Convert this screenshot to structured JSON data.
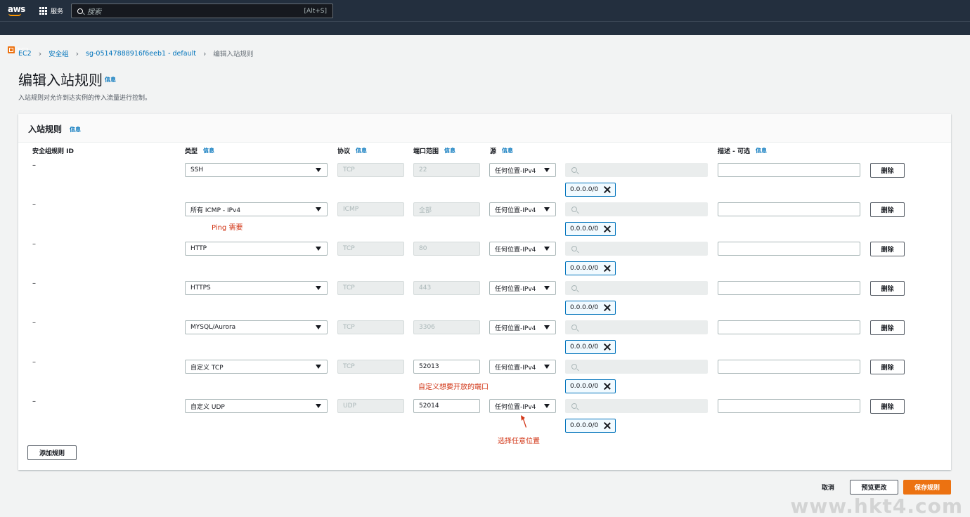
{
  "nav": {
    "logo": "aws",
    "services_label": "服务",
    "search_placeholder": "搜索",
    "search_shortcut": "[Alt+S]",
    "service_pill": "EC2"
  },
  "breadcrumb": {
    "items": [
      "EC2",
      "安全组",
      "sg-05147888916f6eeb1 - default"
    ],
    "current": "编辑入站规则"
  },
  "page": {
    "title": "编辑入站规则",
    "info": "信息",
    "description": "入站规则对允许到达实例的传入流量进行控制。"
  },
  "panel": {
    "title": "入站规则",
    "info": "信息",
    "columns": {
      "rule_id": "安全组规则 ID",
      "type": "类型",
      "protocol": "协议",
      "port_range": "端口范围",
      "source": "源",
      "description": "描述 - 可选",
      "info": "信息"
    },
    "rows": [
      {
        "id": "–",
        "type": "SSH",
        "protocol": "TCP",
        "port": "22",
        "source": "任何位置-IPv4",
        "cidr": "0.0.0.0/0",
        "delete": "删除"
      },
      {
        "id": "–",
        "type": "所有 ICMP - IPv4",
        "protocol": "ICMP",
        "port": "全部",
        "source": "任何位置-IPv4",
        "cidr": "0.0.0.0/0",
        "delete": "删除"
      },
      {
        "id": "–",
        "type": "HTTP",
        "protocol": "TCP",
        "port": "80",
        "source": "任何位置-IPv4",
        "cidr": "0.0.0.0/0",
        "delete": "删除"
      },
      {
        "id": "–",
        "type": "HTTPS",
        "protocol": "TCP",
        "port": "443",
        "source": "任何位置-IPv4",
        "cidr": "0.0.0.0/0",
        "delete": "删除"
      },
      {
        "id": "–",
        "type": "MYSQL/Aurora",
        "protocol": "TCP",
        "port": "3306",
        "source": "任何位置-IPv4",
        "cidr": "0.0.0.0/0",
        "delete": "删除"
      },
      {
        "id": "–",
        "type": "自定义 TCP",
        "protocol": "TCP",
        "port": "52013",
        "source": "任何位置-IPv4",
        "cidr": "0.0.0.0/0",
        "delete": "删除"
      },
      {
        "id": "–",
        "type": "自定义 UDP",
        "protocol": "UDP",
        "port": "52014",
        "source": "任何位置-IPv4",
        "cidr": "0.0.0.0/0",
        "delete": "删除"
      }
    ],
    "add_rule": "添加规则"
  },
  "annotations": {
    "ping": "Ping 需要",
    "custom_port": "自定义想要开放的端口",
    "anywhere": "选择任意位置",
    "color": "#d13212"
  },
  "footer": {
    "cancel": "取消",
    "preview": "预览更改",
    "save": "保存规则"
  },
  "watermark": "www.hkt4.com",
  "colors": {
    "nav_bg": "#232f3e",
    "link": "#0073bb",
    "primary": "#ec7211"
  }
}
